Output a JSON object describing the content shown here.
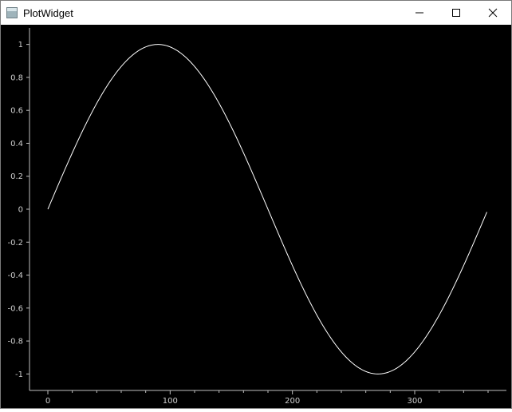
{
  "window": {
    "title": "PlotWidget"
  },
  "titlebar_buttons": {
    "minimize_icon": "minimize-icon",
    "maximize_icon": "maximize-icon",
    "close_icon": "close-icon"
  },
  "colors": {
    "plot_background": "#000000",
    "curve": "#ffffff",
    "axis": "#bfbfbf"
  },
  "chart_data": {
    "type": "line",
    "title": "",
    "xlabel": "",
    "ylabel": "",
    "xlim": [
      -15,
      375
    ],
    "ylim": [
      -1.1,
      1.1
    ],
    "xticks": [
      0,
      100,
      200,
      300
    ],
    "xtick_labels": [
      "0",
      "100",
      "200",
      "300"
    ],
    "yticks": [
      1,
      0.8,
      0.6,
      0.4,
      0.2,
      0,
      -0.2,
      -0.4,
      -0.6,
      -0.8,
      -1
    ],
    "ytick_labels": [
      "1",
      "0.8",
      "0.6",
      "0.4",
      "0.2",
      "0",
      "-0.2",
      "-0.4",
      "-0.6",
      "-0.8",
      "-1"
    ],
    "grid": false,
    "series": [
      {
        "x": [
          0,
          30,
          60,
          90,
          120,
          150,
          180,
          210,
          240,
          270,
          300,
          330,
          359
        ],
        "values": [
          0,
          0.5,
          0.866,
          1,
          0.866,
          0.5,
          0,
          -0.5,
          -0.866,
          -1,
          -0.866,
          -0.5,
          -0.017
        ]
      }
    ]
  }
}
